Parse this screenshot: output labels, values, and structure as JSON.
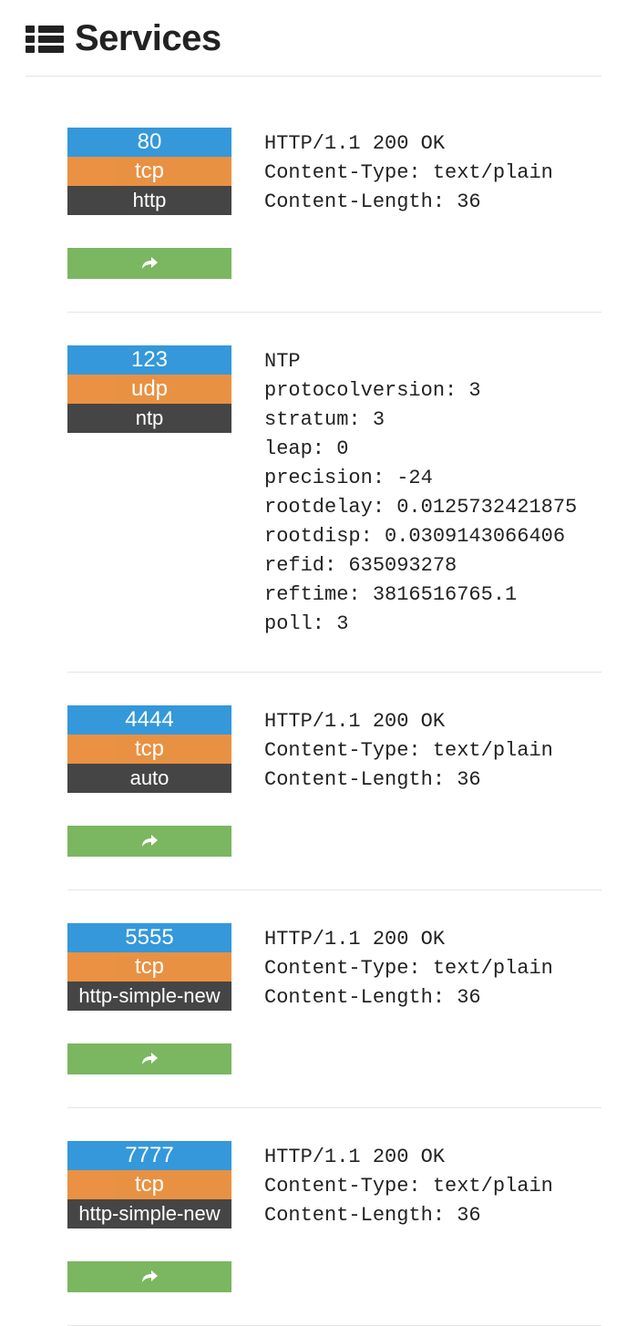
{
  "header": {
    "title": "Services"
  },
  "services": [
    {
      "port": "80",
      "protocol": "tcp",
      "service": "http",
      "has_share": true,
      "detail": "HTTP/1.1 200 OK\nContent-Type: text/plain\nContent-Length: 36"
    },
    {
      "port": "123",
      "protocol": "udp",
      "service": "ntp",
      "has_share": false,
      "detail": "NTP\nprotocolversion: 3\nstratum: 3\nleap: 0\nprecision: -24\nrootdelay: 0.0125732421875\nrootdisp: 0.0309143066406\nrefid: 635093278\nreftime: 3816516765.1\npoll: 3\n"
    },
    {
      "port": "4444",
      "protocol": "tcp",
      "service": "auto",
      "has_share": true,
      "detail": "HTTP/1.1 200 OK\nContent-Type: text/plain\nContent-Length: 36"
    },
    {
      "port": "5555",
      "protocol": "tcp",
      "service": "http-simple-new",
      "has_share": true,
      "detail": "HTTP/1.1 200 OK\nContent-Type: text/plain\nContent-Length: 36"
    },
    {
      "port": "7777",
      "protocol": "tcp",
      "service": "http-simple-new",
      "has_share": true,
      "detail": "HTTP/1.1 200 OK\nContent-Type: text/plain\nContent-Length: 36"
    }
  ]
}
